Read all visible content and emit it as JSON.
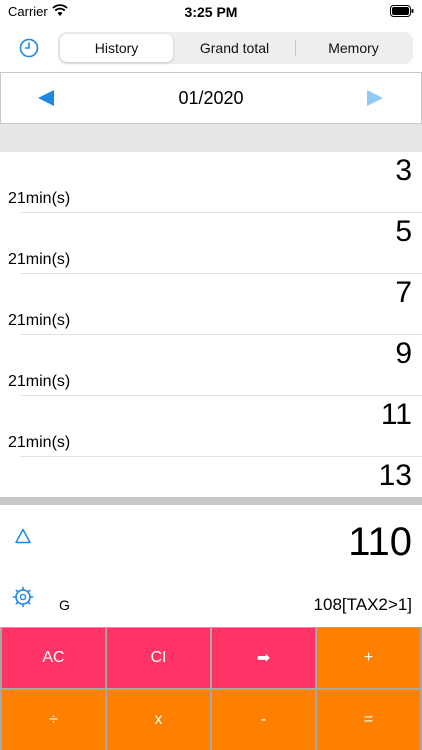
{
  "status": {
    "carrier": "Carrier",
    "time": "3:25 PM"
  },
  "tabs": [
    {
      "label": "History",
      "active": true
    },
    {
      "label": "Grand total",
      "active": false
    },
    {
      "label": "Memory",
      "active": false
    }
  ],
  "month": {
    "label": "01/2020"
  },
  "history": [
    {
      "value": "3",
      "duration": "21min(s)"
    },
    {
      "value": "5",
      "duration": "21min(s)"
    },
    {
      "value": "7",
      "duration": "21min(s)"
    },
    {
      "value": "9",
      "duration": "21min(s)"
    },
    {
      "value": "11",
      "duration": "21min(s)"
    },
    {
      "value": "13",
      "duration": ""
    }
  ],
  "display": {
    "total": "110",
    "mode": "G",
    "expression": "108[TAX2>1]"
  },
  "keys": {
    "ac": "AC",
    "ci": "CI",
    "arrow": "➡",
    "plus": "+",
    "divide": "÷",
    "multiply": "x",
    "minus": "-",
    "equals": "="
  },
  "colors": {
    "accent": "#1e88e5",
    "key_pink": "#ff3366",
    "key_orange": "#ff8000"
  }
}
